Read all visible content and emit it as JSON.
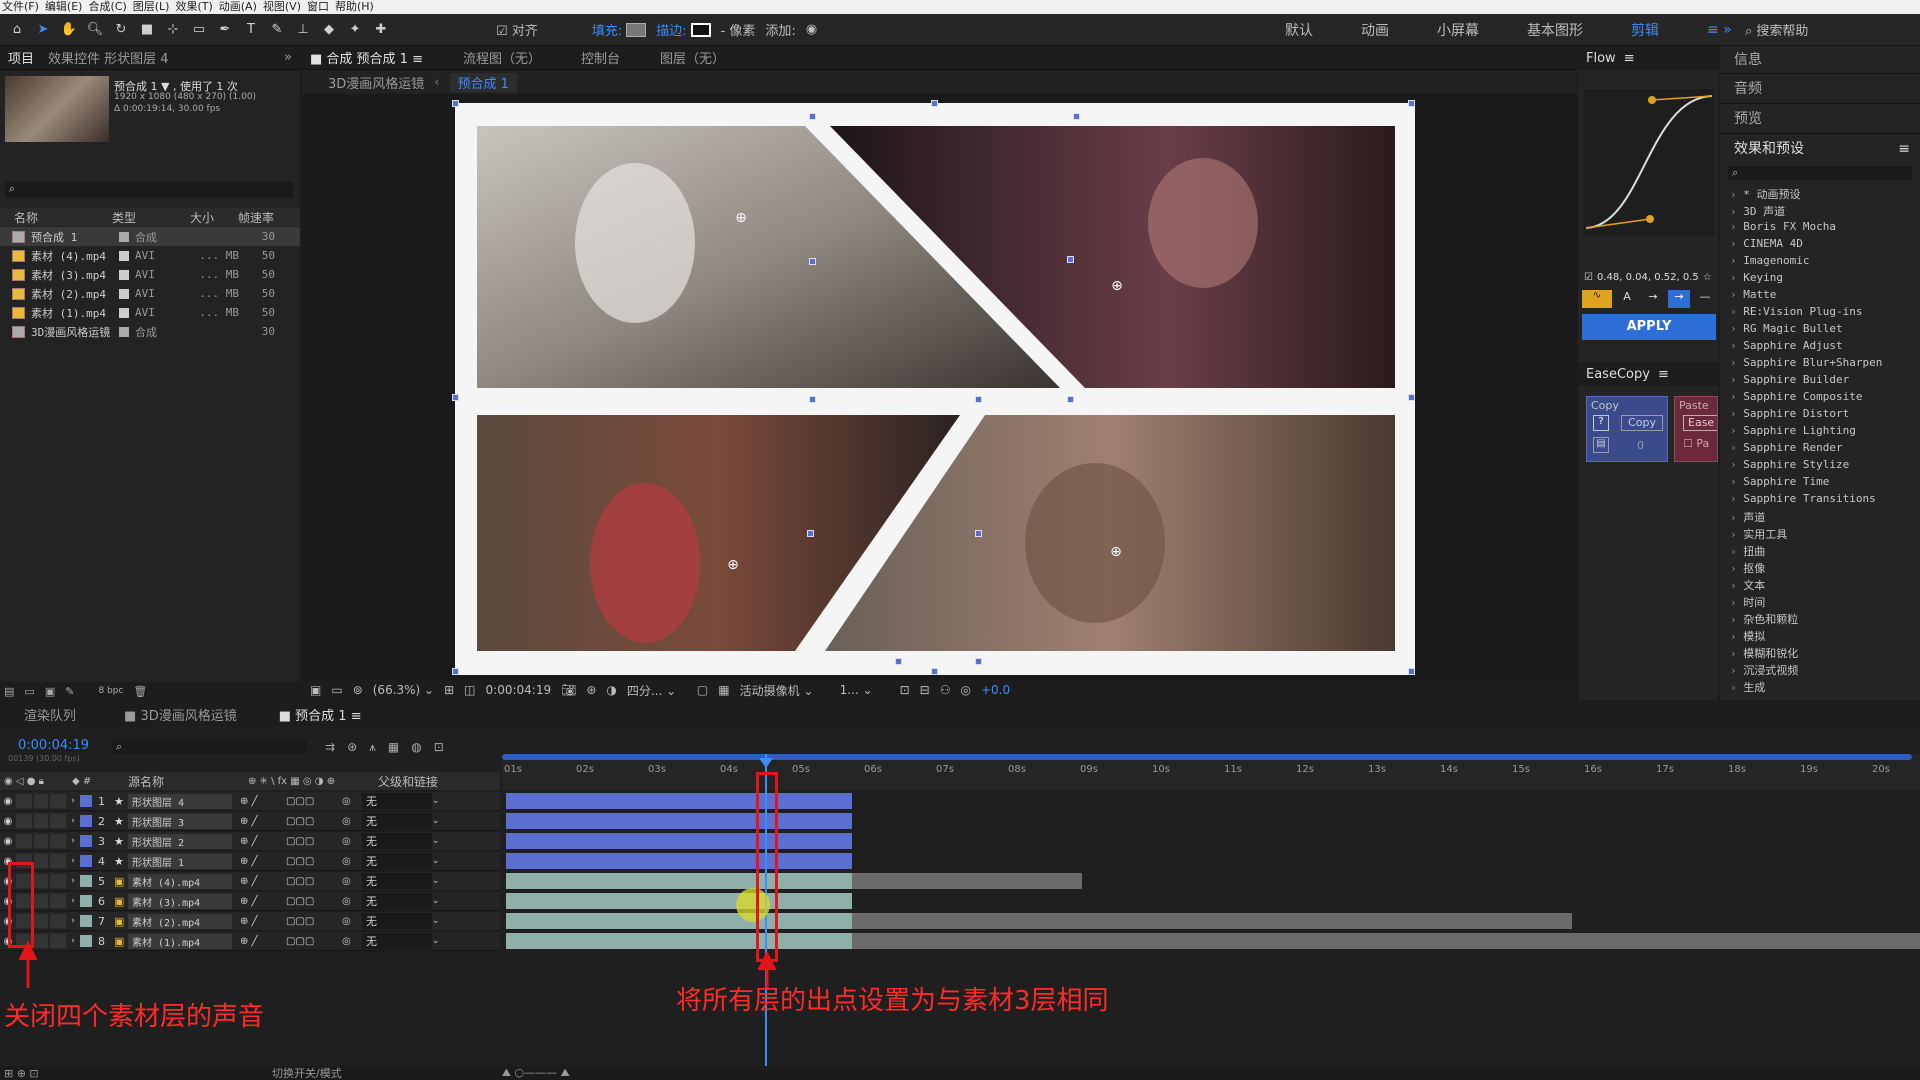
{
  "menu": [
    "文件(F)",
    "编辑(E)",
    "合成(C)",
    "图层(L)",
    "效果(T)",
    "动画(A)",
    "视图(V)",
    "窗口",
    "帮助(H)"
  ],
  "toolbar": {
    "align_label": "对齐",
    "fill_label": "填充:",
    "stroke_label": "描边:",
    "pixel_label": "- 像素",
    "add_label": "添加:",
    "workspaces": [
      "默认",
      "动画",
      "小屏幕",
      "基本图形",
      "剪辑"
    ],
    "active_workspace": "剪辑",
    "search_help": "搜索帮助"
  },
  "project_panel": {
    "tabs": [
      "项目",
      "效果控件 形状图层 4"
    ],
    "preview_name": "预合成 1 ▼ , 使用了 1 次",
    "preview_info1": "1920 x 1080 (480 x 270) (1.00)",
    "preview_info2": "Δ 0:00:19:14, 30.00 fps",
    "columns": [
      "名称",
      "类型",
      "大小",
      "帧速率"
    ],
    "items": [
      {
        "name": "预合成 1",
        "type": "合成",
        "size": "",
        "fps": "30",
        "kind": "comp"
      },
      {
        "name": "素材 (4).mp4",
        "type": "AVI",
        "size": "... MB",
        "fps": "50",
        "kind": "footage"
      },
      {
        "name": "素材 (3).mp4",
        "type": "AVI",
        "size": "... MB",
        "fps": "50",
        "kind": "footage"
      },
      {
        "name": "素材 (2).mp4",
        "type": "AVI",
        "size": "... MB",
        "fps": "50",
        "kind": "footage"
      },
      {
        "name": "素材 (1).mp4",
        "type": "AVI",
        "size": "... MB",
        "fps": "50",
        "kind": "footage"
      },
      {
        "name": "3D漫画风格运镜",
        "type": "合成",
        "size": "",
        "fps": "30",
        "kind": "comp"
      }
    ],
    "bpc": "8 bpc"
  },
  "comp_panel": {
    "tabs": [
      "合成 预合成 1",
      "流程图（无）",
      "控制台",
      "图层（无）"
    ],
    "breadcrumb": [
      "3D漫画风格运镜",
      "预合成 1"
    ],
    "zoom": "(66.3%)",
    "timecode": "0:00:04:19",
    "resolution": "四分...",
    "camera": "活动摄像机",
    "views": "1...",
    "exposure": "+0.0"
  },
  "flow_panel": {
    "title": "Flow",
    "values": "0.48, 0.04, 0.52, 0.5",
    "apply_label": "APPLY",
    "easecopy_title": "EaseCopy",
    "copy_label": "Copy",
    "paste_label": "Paste",
    "copy_btn": "Copy",
    "ease_btn": "Ease",
    "zero": "0",
    "pa": "Pa"
  },
  "right_panel": {
    "sections": [
      "信息",
      "音频",
      "预览",
      "效果和预设"
    ],
    "effects": [
      "* 动画预设",
      "3D 声道",
      "Boris FX Mocha",
      "CINEMA 4D",
      "Imagenomic",
      "Keying",
      "Matte",
      "RE:Vision Plug-ins",
      "RG Magic Bullet",
      "Sapphire Adjust",
      "Sapphire Blur+Sharpen",
      "Sapphire Builder",
      "Sapphire Composite",
      "Sapphire Distort",
      "Sapphire Lighting",
      "Sapphire Render",
      "Sapphire Stylize",
      "Sapphire Time",
      "Sapphire Transitions",
      "声道",
      "实用工具",
      "扭曲",
      "抠像",
      "文本",
      "时间",
      "杂色和颗粒",
      "模拟",
      "模糊和锐化",
      "沉浸式视频",
      "生成"
    ]
  },
  "timeline": {
    "tabs": [
      "渲染队列",
      "3D漫画风格运镜",
      "预合成 1"
    ],
    "timecode": "0:00:04:19",
    "timecode_sub": "00139 (30.00 fps)",
    "col_source": "源名称",
    "col_parent": "父级和链接",
    "ruler": [
      "01s",
      "02s",
      "03s",
      "04s",
      "05s",
      "06s",
      "07s",
      "08s",
      "09s",
      "10s",
      "11s",
      "12s",
      "13s",
      "14s",
      "15s",
      "16s",
      "17s",
      "18s",
      "19s",
      "20s"
    ],
    "layers": [
      {
        "num": "1",
        "name": "形状图层 4",
        "parent": "无",
        "color": "#5b6fd0",
        "end_sec": 4.8
      },
      {
        "num": "2",
        "name": "形状图层 3",
        "parent": "无",
        "color": "#5b6fd0",
        "end_sec": 4.8
      },
      {
        "num": "3",
        "name": "形状图层 2",
        "parent": "无",
        "color": "#5b6fd0",
        "end_sec": 4.8
      },
      {
        "num": "4",
        "name": "形状图层 1",
        "parent": "无",
        "color": "#5b6fd0",
        "end_sec": 4.8
      },
      {
        "num": "5",
        "name": "素材 (4).mp4",
        "parent": "无",
        "color": "#8fb0aa",
        "end_sec": 8.0
      },
      {
        "num": "6",
        "name": "素材 (3).mp4",
        "parent": "无",
        "color": "#8fb0aa",
        "end_sec": 4.8
      },
      {
        "num": "7",
        "name": "素材 (2).mp4",
        "parent": "无",
        "color": "#8fb0aa",
        "end_sec": 14.8
      },
      {
        "num": "8",
        "name": "素材 (1).mp4",
        "parent": "无",
        "color": "#8fb0aa",
        "end_sec": 19.9
      }
    ],
    "footer_label": "切换开关/模式"
  },
  "annotations": {
    "left": "关闭四个素材层的声音",
    "center": "将所有层的出点设置为与素材3层相同"
  }
}
